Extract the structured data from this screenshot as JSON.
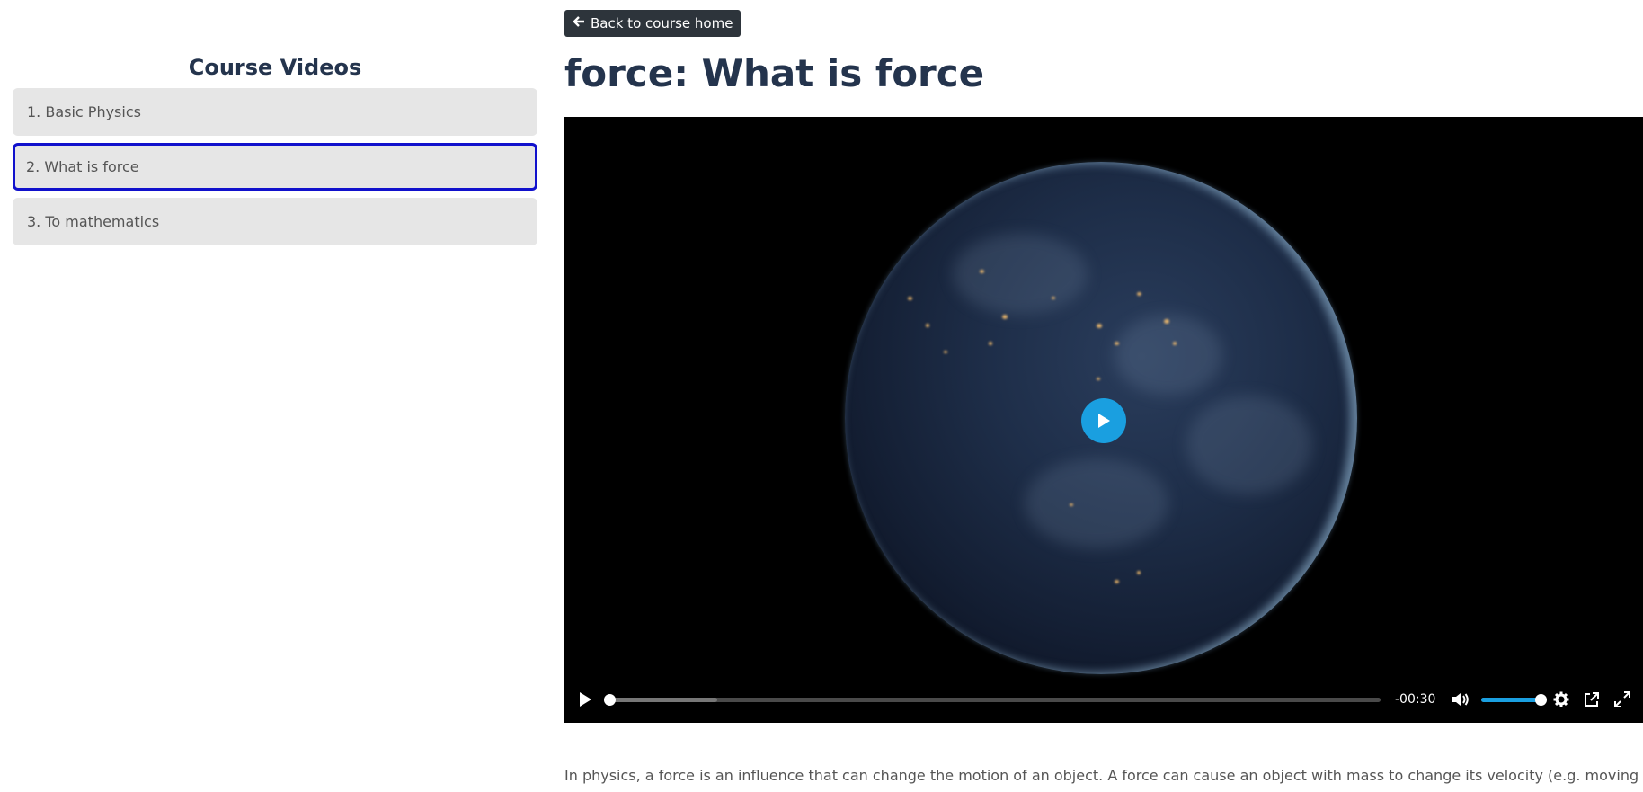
{
  "sidebar": {
    "title": "Course Videos",
    "items": [
      {
        "label": "1. Basic Physics",
        "active": false
      },
      {
        "label": "2. What is force",
        "active": true
      },
      {
        "label": "3. To mathematics",
        "active": false
      }
    ]
  },
  "header": {
    "back_label": "Back to course home",
    "title": "force: What is force"
  },
  "player": {
    "time_remaining": "-00:30",
    "progress_fraction": 0.0,
    "buffered_fraction": 0.14,
    "volume_fraction": 1.0,
    "accent_color": "#1a9fe0"
  },
  "description": {
    "text": "In physics, a force is an influence that can change the motion of an object. A force can cause an object with mass to change its velocity (e.g. moving"
  }
}
